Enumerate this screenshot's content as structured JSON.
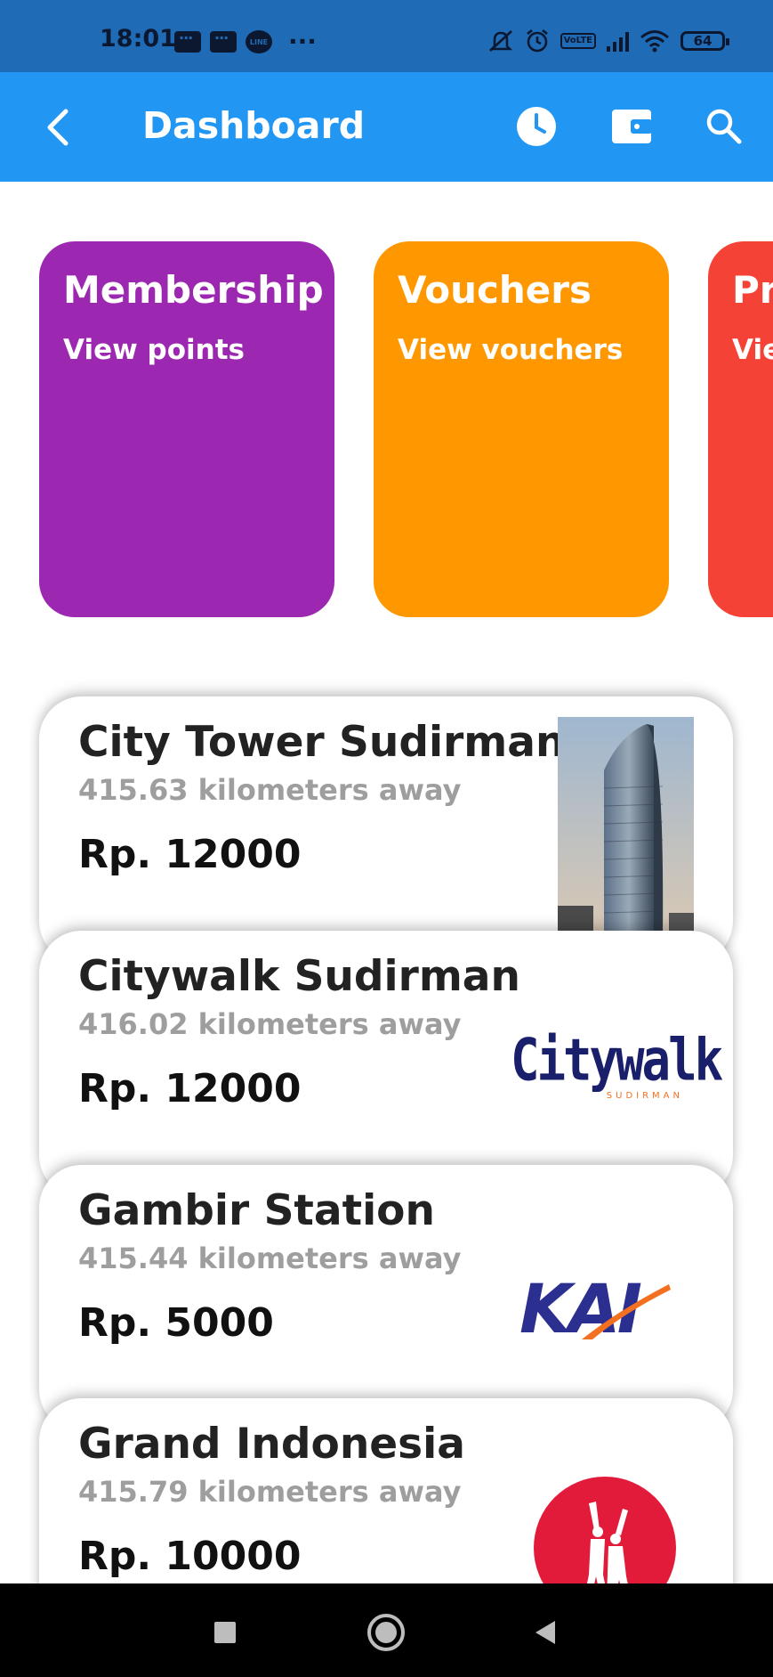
{
  "status_bar": {
    "time": "18:01",
    "line_label": "LINE",
    "more": "···",
    "volte": "VoLTE",
    "battery": "64"
  },
  "app_bar": {
    "title": "Dashboard",
    "icons": [
      "back-arrow-icon",
      "clock-icon",
      "wallet-icon",
      "search-icon"
    ]
  },
  "categories": [
    {
      "title": "Membership",
      "subtitle": "View points",
      "color": "#9c27b0"
    },
    {
      "title": "Vouchers",
      "subtitle": "View vouchers",
      "color": "#ff9800"
    },
    {
      "title": "Pr",
      "subtitle": "Vie",
      "color": "#f44336"
    }
  ],
  "places": [
    {
      "name": "City Tower Sudirman",
      "distance": "415.63 kilometers away",
      "price": "Rp. 12000"
    },
    {
      "name": "Citywalk Sudirman",
      "distance": "416.02 kilometers away",
      "price": "Rp. 12000",
      "logo_text": "Citywalk",
      "logo_sub": "SUDIRMAN"
    },
    {
      "name": "Gambir Station",
      "distance": "415.44 kilometers away",
      "price": "Rp. 5000",
      "logo_text": "KAI"
    },
    {
      "name": "Grand Indonesia",
      "distance": "415.79 kilometers away",
      "price": "Rp. 10000"
    }
  ],
  "colors": {
    "status_bar": "#1f6bb5",
    "app_bar": "#2196f3",
    "membership": "#9c27b0",
    "vouchers": "#ff9800",
    "promo": "#f44336",
    "kai_blue": "#2b2f8f",
    "kai_orange": "#f37021",
    "citywalk_navy": "#1a1f6b",
    "grand_red": "#e31b3b"
  }
}
